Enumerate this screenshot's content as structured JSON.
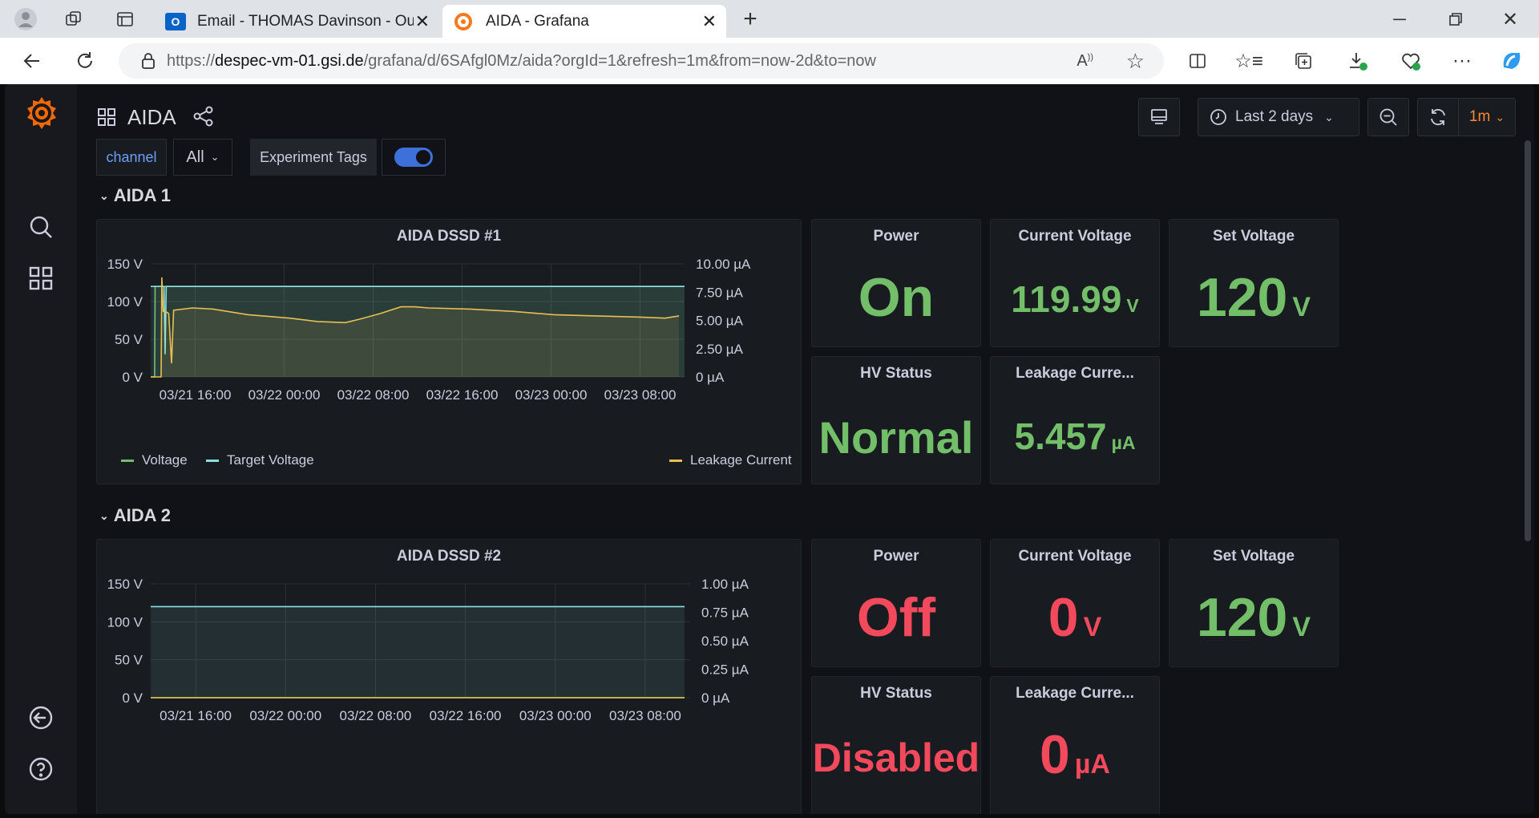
{
  "browser": {
    "tabs": [
      {
        "title": "Email - THOMAS Davinson - Outl"
      },
      {
        "title": "AIDA - Grafana"
      }
    ],
    "url_host_prefix": "https://",
    "url_host": "despec-vm-01.gsi.de",
    "url_path": "/grafana/d/6SAfgl0Mz/aida?orgId=1&refresh=1m&from=now-2d&to=now"
  },
  "dashboard": {
    "title": "AIDA",
    "time_range": "Last 2 days",
    "refresh": "1m",
    "variables": {
      "channel_label": "channel",
      "channel_value": "All",
      "tags_label": "Experiment Tags"
    }
  },
  "rows": [
    {
      "title": "AIDA 1",
      "graph": {
        "title": "AIDA DSSD #1",
        "left_ticks": [
          "150 V",
          "100 V",
          "50 V",
          "0 V"
        ],
        "right_ticks": [
          "10.00 µA",
          "7.50 µA",
          "5.00 µA",
          "2.50 µA",
          "0 µA"
        ],
        "x_ticks": [
          "03/21 16:00",
          "03/22 00:00",
          "03/22 08:00",
          "03/22 16:00",
          "03/23 00:00",
          "03/23 08:00"
        ],
        "legend": [
          "Voltage",
          "Target Voltage",
          "Leakage Current"
        ]
      },
      "power": {
        "title": "Power",
        "value": "On"
      },
      "current_voltage": {
        "title": "Current Voltage",
        "value": "119.99",
        "unit": "V"
      },
      "set_voltage": {
        "title": "Set Voltage",
        "value": "120",
        "unit": "V"
      },
      "hv_status": {
        "title": "HV Status",
        "value": "Normal"
      },
      "leakage": {
        "title": "Leakage Curre...",
        "value": "5.457",
        "unit": "µA"
      }
    },
    {
      "title": "AIDA 2",
      "graph": {
        "title": "AIDA DSSD #2",
        "left_ticks": [
          "150 V",
          "100 V",
          "50 V",
          "0 V"
        ],
        "right_ticks": [
          "1.00 µA",
          "0.75 µA",
          "0.50 µA",
          "0.25 µA",
          "0 µA"
        ],
        "x_ticks": [
          "03/21 16:00",
          "03/22 00:00",
          "03/22 08:00",
          "03/22 16:00",
          "03/23 00:00",
          "03/23 08:00"
        ]
      },
      "power": {
        "title": "Power",
        "value": "Off"
      },
      "current_voltage": {
        "title": "Current Voltage",
        "value": "0",
        "unit": "V"
      },
      "set_voltage": {
        "title": "Set Voltage",
        "value": "120",
        "unit": "V"
      },
      "hv_status": {
        "title": "HV Status",
        "value": "Disabled"
      },
      "leakage": {
        "title": "Leakage Curre...",
        "value": "0",
        "unit": "µA"
      }
    }
  ],
  "chart_data": [
    {
      "type": "line",
      "title": "AIDA DSSD #1",
      "x_unit": "hours since 03/21 12:00",
      "ylim_left": [
        0,
        150
      ],
      "ylim_right": [
        0,
        10
      ],
      "series": [
        {
          "name": "Voltage",
          "axis": "left",
          "color": "#73bf69",
          "points": [
            [
              0,
              0
            ],
            [
              0.35,
              0
            ],
            [
              0.4,
              120
            ],
            [
              1.3,
              120
            ],
            [
              1.4,
              120
            ],
            [
              48.3,
              120
            ]
          ]
        },
        {
          "name": "Target Voltage",
          "axis": "left",
          "color": "#8ae0e0",
          "points": [
            [
              0,
              120
            ],
            [
              1.2,
              120
            ],
            [
              1.3,
              30
            ],
            [
              1.4,
              120
            ],
            [
              48.3,
              120
            ]
          ]
        },
        {
          "name": "Leakage Current",
          "axis": "right",
          "color": "#e8c052",
          "points": [
            [
              0,
              0
            ],
            [
              1.5,
              0
            ],
            [
              1.6,
              8.8
            ],
            [
              1.8,
              5.8
            ],
            [
              2.4,
              5.7
            ],
            [
              2.6,
              5.6
            ],
            [
              3.0,
              1.2
            ],
            [
              3.3,
              5.9
            ],
            [
              6,
              6.1
            ],
            [
              9,
              6.0
            ],
            [
              14,
              5.5
            ],
            [
              20,
              5.2
            ],
            [
              24,
              4.9
            ],
            [
              28,
              4.8
            ],
            [
              30,
              5.1
            ],
            [
              33,
              5.6
            ],
            [
              36,
              6.2
            ],
            [
              38,
              6.2
            ],
            [
              40,
              6.1
            ],
            [
              46,
              6.0
            ],
            [
              52,
              5.8
            ],
            [
              58,
              5.5
            ],
            [
              64,
              5.4
            ],
            [
              70,
              5.3
            ],
            [
              74,
              5.2
            ],
            [
              76,
              5.4
            ]
          ]
        }
      ]
    },
    {
      "type": "line",
      "title": "AIDA DSSD #2",
      "x_unit": "hours since 03/21 12:00",
      "ylim_left": [
        0,
        150
      ],
      "ylim_right": [
        0,
        1
      ],
      "series": [
        {
          "name": "Voltage",
          "axis": "left",
          "color": "#73bf69",
          "points": [
            [
              0,
              0
            ],
            [
              47.5,
              0
            ]
          ]
        },
        {
          "name": "Target Voltage",
          "axis": "left",
          "color": "#8ae0e0",
          "points": [
            [
              0,
              120
            ],
            [
              47.5,
              120
            ]
          ]
        },
        {
          "name": "Leakage Current",
          "axis": "right",
          "color": "#e8c052",
          "points": [
            [
              0,
              0
            ],
            [
              47.5,
              0
            ]
          ]
        }
      ]
    }
  ]
}
